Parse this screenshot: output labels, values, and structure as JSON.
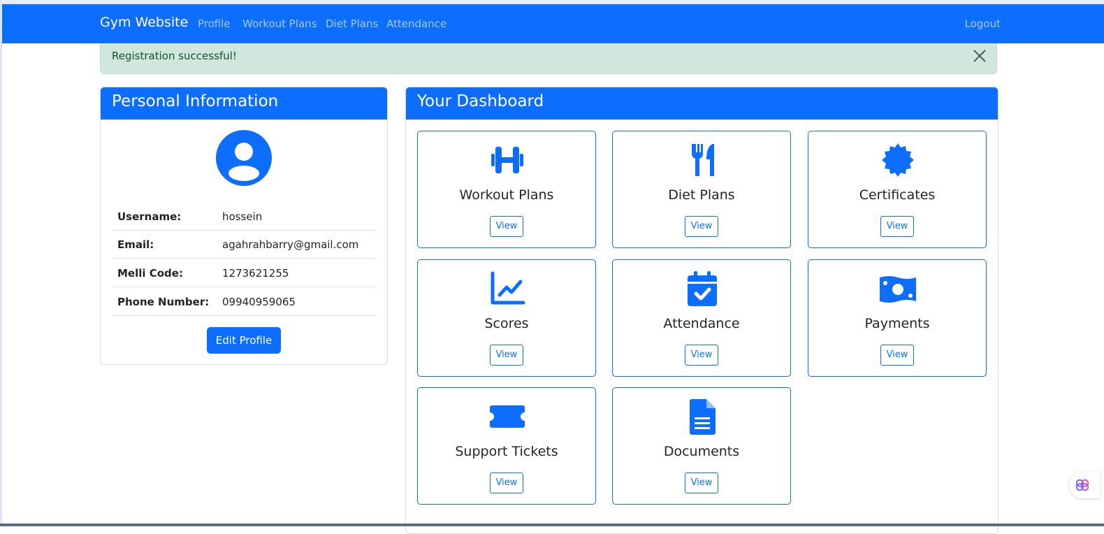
{
  "navbar": {
    "brand": "Gym Website",
    "links": [
      "Profile",
      "Workout Plans",
      "Diet Plans",
      "Attendance"
    ],
    "logout": "Logout"
  },
  "alert": {
    "message": "Registration successful!",
    "close_icon": "close-icon"
  },
  "personal_info": {
    "title": "Personal Information",
    "avatar_icon": "user-circle-icon",
    "rows": [
      {
        "label": "Username:",
        "value": "hossein"
      },
      {
        "label": "Email:",
        "value": "agahrahbarry@gmail.com"
      },
      {
        "label": "Melli Code:",
        "value": "1273621255"
      },
      {
        "label": "Phone Number:",
        "value": "09940959065"
      }
    ],
    "edit_button": "Edit Profile"
  },
  "dashboard": {
    "title": "Your Dashboard",
    "cards": [
      {
        "title": "Workout Plans",
        "icon": "dumbbell-icon",
        "button": "View"
      },
      {
        "title": "Diet Plans",
        "icon": "utensils-icon",
        "button": "View"
      },
      {
        "title": "Certificates",
        "icon": "certificate-icon",
        "button": "View"
      },
      {
        "title": "Scores",
        "icon": "chart-line-icon",
        "button": "View"
      },
      {
        "title": "Attendance",
        "icon": "calendar-check-icon",
        "button": "View"
      },
      {
        "title": "Payments",
        "icon": "money-bill-icon",
        "button": "View"
      },
      {
        "title": "Support Tickets",
        "icon": "ticket-icon",
        "button": "View"
      },
      {
        "title": "Documents",
        "icon": "file-document-icon",
        "button": "View"
      }
    ]
  },
  "colors": {
    "primary": "#0d6efd",
    "alert_bg": "#d1e7dd",
    "alert_text": "#0f5132"
  }
}
